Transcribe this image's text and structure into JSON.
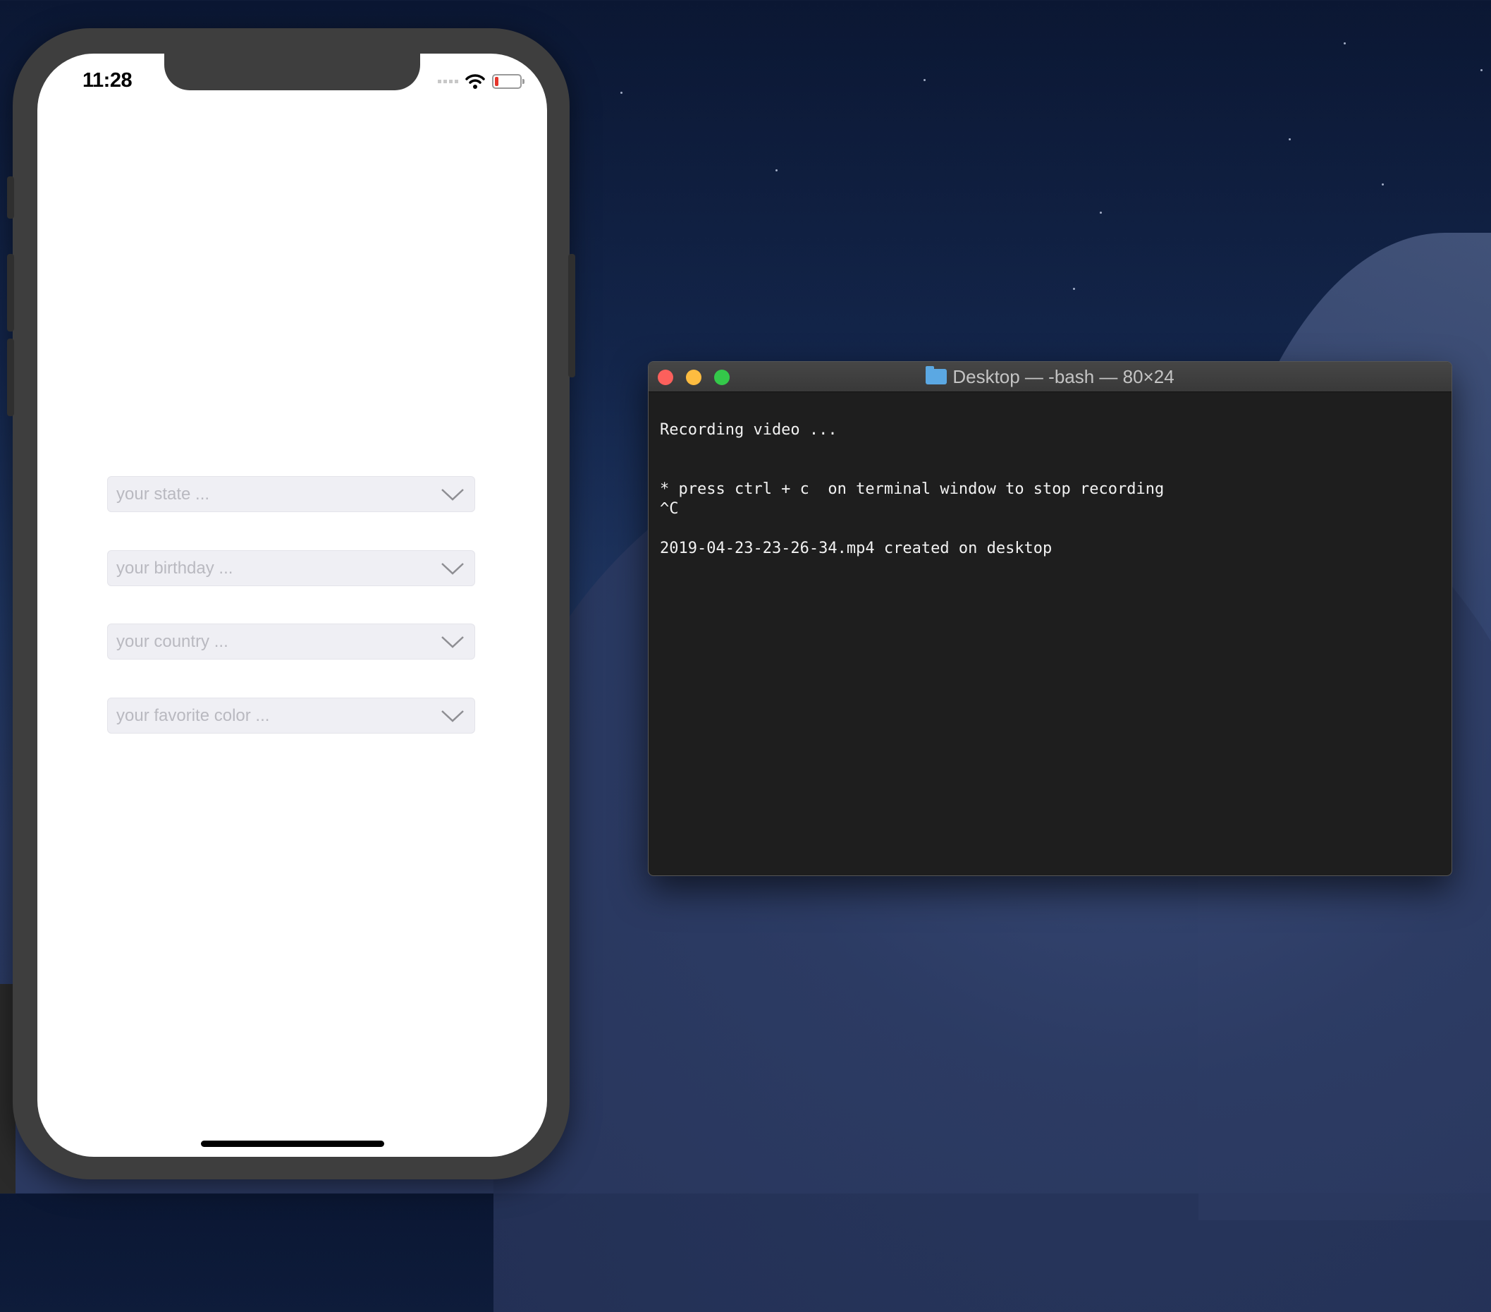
{
  "desktop": {
    "wallpaper": "macOS Mojave night"
  },
  "simulator": {
    "status_bar": {
      "time": "11:28",
      "icons": [
        "signal-icon",
        "wifi-icon",
        "battery-icon"
      ],
      "battery_level": 0.15,
      "battery_color": "#e5362c"
    },
    "fields": [
      {
        "placeholder": "your state ..."
      },
      {
        "placeholder": "your birthday ..."
      },
      {
        "placeholder": "your country ..."
      },
      {
        "placeholder": "your favorite color ..."
      }
    ]
  },
  "terminal": {
    "title": "Desktop — -bash — 80×24",
    "traffic_lights": {
      "close": "#fc605c",
      "minimize": "#fdbc40",
      "zoom": "#34c84a"
    },
    "lines": [
      "Recording video ...",
      "",
      "",
      "* press ctrl + c  on terminal window to stop recording",
      "^C",
      "",
      "2019-04-23-23-26-34.mp4 created on desktop"
    ]
  }
}
